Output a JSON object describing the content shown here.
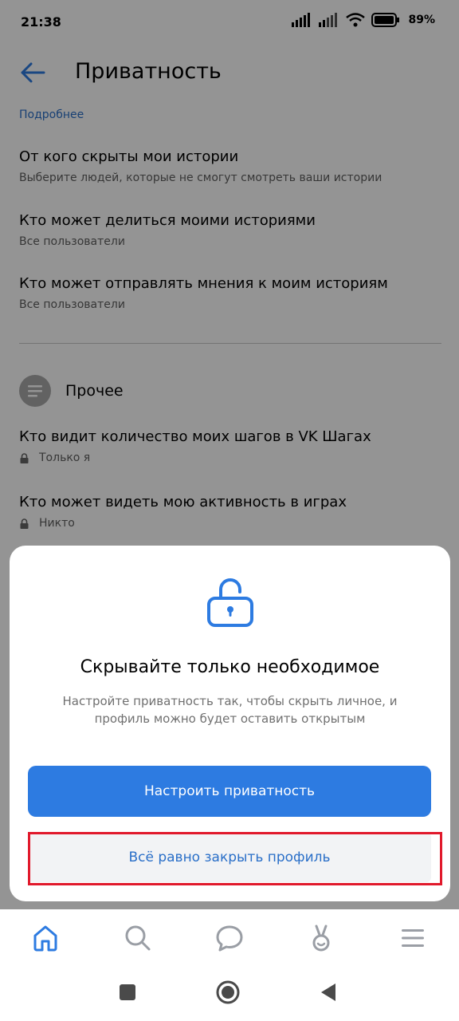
{
  "status_bar": {
    "time": "21:38",
    "battery": "89%"
  },
  "header": {
    "title": "Приватность"
  },
  "more_link": "Подробнее",
  "settings": [
    {
      "title": "От кого скрыты мои истории",
      "subtitle": "Выберите людей, которые не смогут смотреть ваши истории"
    },
    {
      "title": "Кто может делиться моими историями",
      "subtitle": "Все пользователи"
    },
    {
      "title": "Кто может отправлять мнения к моим историям",
      "subtitle": "Все пользователи"
    }
  ],
  "section": {
    "title": "Прочее"
  },
  "other_settings": [
    {
      "title": "Кто видит количество моих шагов в VK Шагах",
      "subtitle": "Только я"
    },
    {
      "title": "Кто может видеть мою активность в играх",
      "subtitle": "Никто"
    }
  ],
  "sheet": {
    "title": "Скрывайте только необходимое",
    "description": "Настройте приватность так, чтобы скрыть личное, и профиль можно будет оставить открытым",
    "primary_button": "Настроить приватность",
    "secondary_button": "Всё равно закрыть профиль"
  },
  "bottom_nav": [
    "home-icon",
    "search-icon",
    "messages-icon",
    "clips-icon",
    "menu-icon"
  ],
  "colors": {
    "accent": "#2d7be1",
    "link": "#2a6fc8",
    "highlight": "#e1192b"
  }
}
